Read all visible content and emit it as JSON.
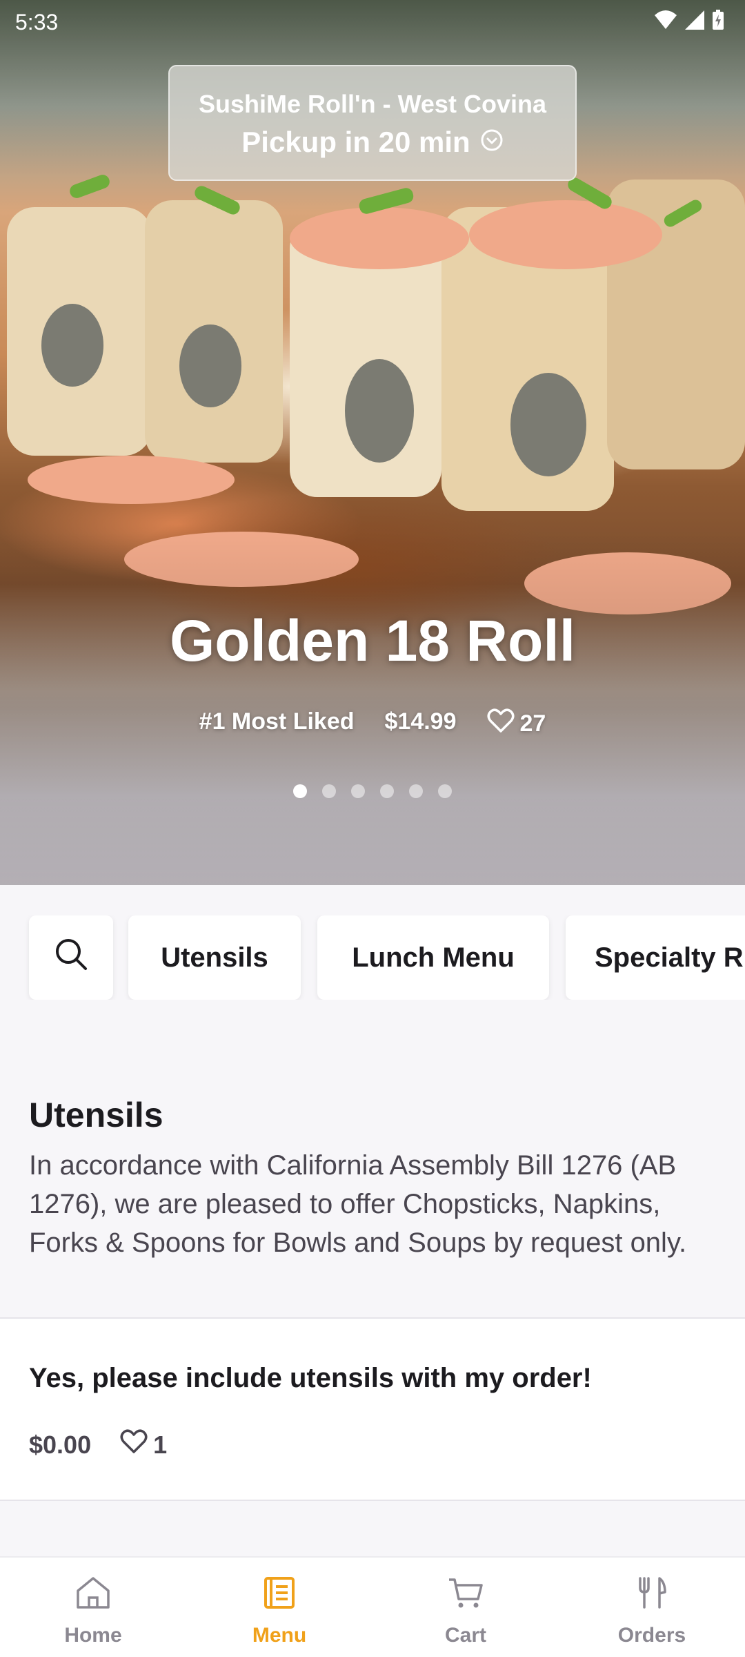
{
  "status_bar": {
    "time": "5:33"
  },
  "store": {
    "name": "SushiMe Roll'n - West Covina",
    "pickup": "Pickup in 20 min"
  },
  "hero": {
    "title": "Golden 18 Roll",
    "rank": "#1 Most Liked",
    "price": "$14.99",
    "likes": "27",
    "dots_total": 6,
    "active_dot": 0
  },
  "categories": {
    "items": [
      "Utensils",
      "Lunch Menu",
      "Specialty R"
    ]
  },
  "section": {
    "title": "Utensils",
    "description": "In accordance with California Assembly Bill 1276 (AB 1276), we are pleased to offer Chopsticks, Napkins, Forks & Spoons for Bowls and Soups by request only."
  },
  "item": {
    "name": "Yes, please include utensils with my order!",
    "price": "$0.00",
    "likes": "1"
  },
  "nav": {
    "items": [
      {
        "label": "Home",
        "icon": "home-icon"
      },
      {
        "label": "Menu",
        "icon": "menu-icon"
      },
      {
        "label": "Cart",
        "icon": "cart-icon"
      },
      {
        "label": "Orders",
        "icon": "utensils-icon"
      }
    ],
    "active": "Menu",
    "accent_color": "#f0a11a"
  }
}
